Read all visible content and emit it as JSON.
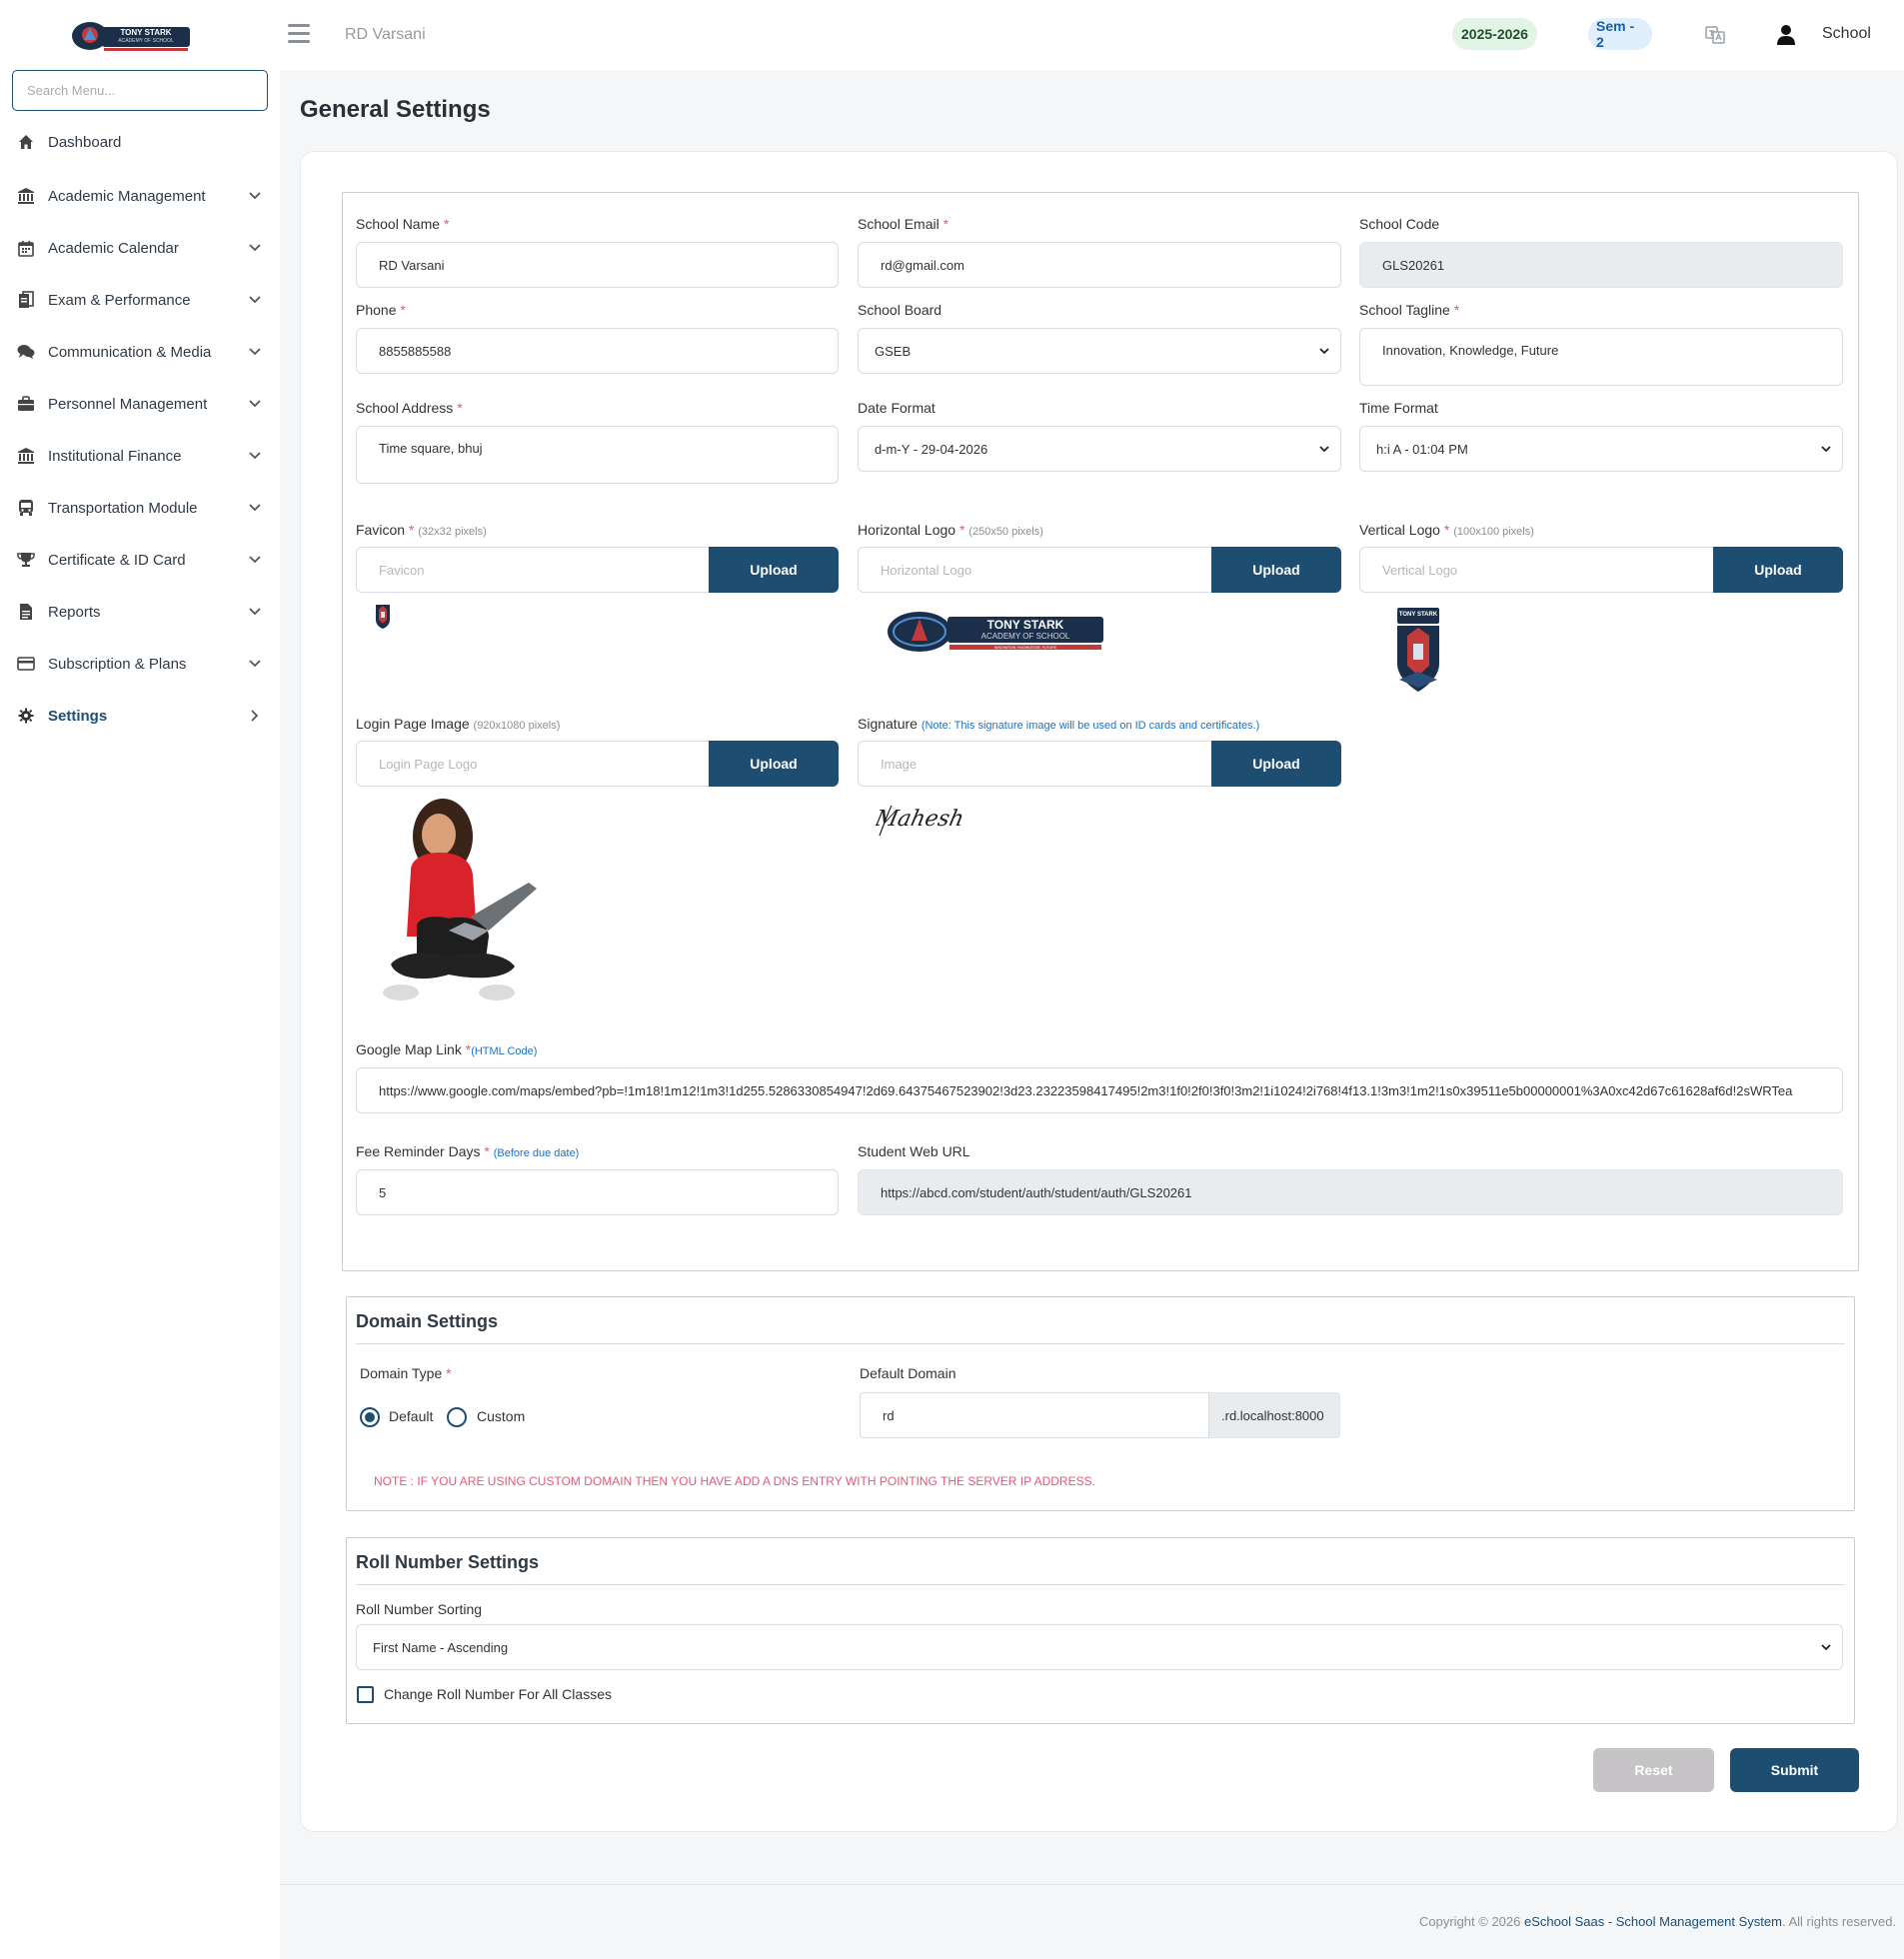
{
  "header": {
    "school_title": "RD Varsani",
    "session_year": "2025-2026",
    "semester": "Sem - 2",
    "user_label": "School"
  },
  "logo": {
    "line1": "TONY STARK",
    "line2": "ACADEMY OF SCHOOL",
    "tagline": "INNOVATION, KNOWLEDGE, FUTURE"
  },
  "sidebar": {
    "search_placeholder": "Search Menu...",
    "items": [
      {
        "label": "Dashboard",
        "icon": "home-icon"
      },
      {
        "label": "Academic Management",
        "icon": "institution-icon"
      },
      {
        "label": "Academic Calendar",
        "icon": "calendar-icon"
      },
      {
        "label": "Exam & Performance",
        "icon": "exam-icon"
      },
      {
        "label": "Communication & Media",
        "icon": "chat-icon"
      },
      {
        "label": "Personnel Management",
        "icon": "briefcase-icon"
      },
      {
        "label": "Institutional Finance",
        "icon": "bank-icon"
      },
      {
        "label": "Transportation Module",
        "icon": "bus-icon"
      },
      {
        "label": "Certificate & ID Card",
        "icon": "trophy-icon"
      },
      {
        "label": "Reports",
        "icon": "file-icon"
      },
      {
        "label": "Subscription & Plans",
        "icon": "credit-card-icon"
      },
      {
        "label": "Settings",
        "icon": "gear-icon",
        "active": true
      }
    ]
  },
  "page": {
    "title": "General Settings"
  },
  "general": {
    "school_name": {
      "label": "School Name",
      "value": "RD Varsani"
    },
    "school_email": {
      "label": "School Email",
      "value": "rd@gmail.com"
    },
    "school_code": {
      "label": "School Code",
      "value": "GLS20261"
    },
    "phone": {
      "label": "Phone",
      "value": "8855885588"
    },
    "school_board": {
      "label": "School Board",
      "value": "GSEB"
    },
    "school_tagline": {
      "label": "School Tagline",
      "value": "Innovation, Knowledge, Future"
    },
    "school_address": {
      "label": "School Address",
      "value": "Time square, bhuj"
    },
    "date_format": {
      "label": "Date Format",
      "value": "d-m-Y - 29-04-2026"
    },
    "time_format": {
      "label": "Time Format",
      "value": "h:i A - 01:04 PM"
    },
    "favicon": {
      "label": "Favicon",
      "hint": "(32x32 pixels)",
      "placeholder": "Favicon"
    },
    "horizontal_logo": {
      "label": "Horizontal Logo",
      "hint": "(250x50 pixels)",
      "placeholder": "Horizontal Logo"
    },
    "vertical_logo": {
      "label": "Vertical Logo",
      "hint": "(100x100 pixels)",
      "placeholder": "Vertical Logo"
    },
    "login_image": {
      "label": "Login Page Image",
      "hint": "(920x1080 pixels)",
      "placeholder": "Login Page Logo"
    },
    "signature": {
      "label": "Signature",
      "note": "(Note: This signature image will be used on ID cards and certificates.)",
      "placeholder": "Image",
      "signature_text": "Mahesh"
    },
    "upload_label": "Upload",
    "google_map": {
      "label": "Google Map Link",
      "note": "(HTML Code)",
      "value": "https://www.google.com/maps/embed?pb=!1m18!1m12!1m3!1d255.5286330854947!2d69.64375467523902!3d23.23223598417495!2m3!1f0!2f0!3f0!3m2!1i1024!2i768!4f13.1!3m3!1m2!1s0x39511e5b00000001%3A0xc42d67c61628af6d!2sWRTea"
    },
    "fee_reminder": {
      "label": "Fee Reminder Days",
      "note": "(Before due date)",
      "value": "5"
    },
    "student_web_url": {
      "label": "Student Web URL",
      "value": "https://abcd.com/student/auth/student/auth/GLS20261"
    }
  },
  "domain": {
    "title": "Domain Settings",
    "type_label": "Domain Type",
    "option_default": "Default",
    "option_custom": "Custom",
    "default_domain_label": "Default Domain",
    "default_domain_value": "rd",
    "suffix": ".rd.localhost:8000",
    "note": "NOTE : IF YOU ARE USING CUSTOM DOMAIN THEN YOU HAVE ADD A DNS ENTRY WITH POINTING THE SERVER IP ADDRESS."
  },
  "roll": {
    "title": "Roll Number Settings",
    "sorting_label": "Roll Number Sorting",
    "sorting_value": "First Name - Ascending",
    "change_all_label": "Change Roll Number For All Classes"
  },
  "actions": {
    "reset": "Reset",
    "submit": "Submit"
  },
  "footer": {
    "prefix": "Copyright © 2026 ",
    "brand": "eSchool Saas - School Management System",
    "suffix": ". All rights reserved."
  }
}
